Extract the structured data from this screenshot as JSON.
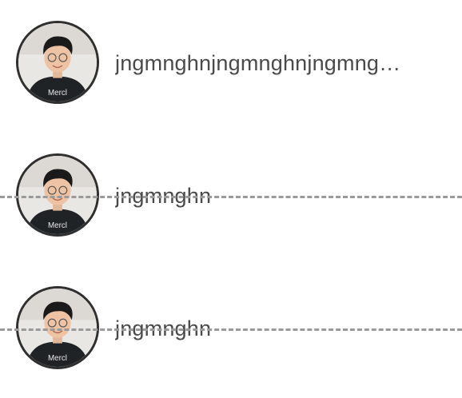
{
  "list": {
    "items": [
      {
        "name": "jngmnghnjngmnghnjngmng…",
        "avatar_icon": "user-avatar-photo",
        "struck": false
      },
      {
        "name": "jngmnghn",
        "avatar_icon": "user-avatar-photo",
        "struck": true
      },
      {
        "name": "jngmnghn",
        "avatar_icon": "user-avatar-photo",
        "struck": true
      }
    ]
  },
  "colors": {
    "text": "#4a4a4a",
    "avatar_border": "#2f2f2f",
    "dash": "#9a9a9a",
    "background": "#ffffff"
  }
}
